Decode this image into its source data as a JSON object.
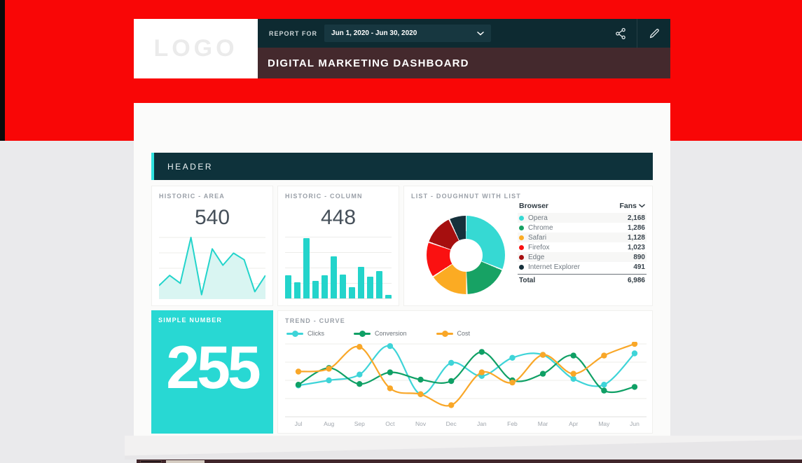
{
  "colors": {
    "red": "#f90606",
    "page_bg": "#eaeaec",
    "topbar_bg": "#0d2a31",
    "dropdown_bg": "#173740",
    "titlebar_bg": "#44292d",
    "banner_bg": "#0e323b",
    "accent_cyan": "#2fe2df",
    "teal": "#23d4cb",
    "simple_number_bg": "#28d8d3"
  },
  "logo": {
    "text": "LOGO"
  },
  "topbar": {
    "report_for_label": "REPORT FOR",
    "date_range": "Jun 1, 2020 - Jun 30, 2020",
    "share_icon": "share-icon",
    "edit_icon": "pencil-icon",
    "chevron_icon": "chevron-down-icon"
  },
  "titlebar": {
    "title": "DIGITAL MARKETING DASHBOARD"
  },
  "banner": {
    "label": "HEADER"
  },
  "cards": {
    "historic_area": {
      "title": "HISTORIC - AREA",
      "value": "540",
      "chart_data": {
        "type": "area",
        "values": [
          20,
          37,
          24,
          100,
          5,
          81,
          54,
          74,
          63,
          10,
          37
        ],
        "ylim": [
          0,
          100
        ],
        "color": "#23d4cb",
        "fill": "#d9f5f2",
        "grid": true
      }
    },
    "historic_column": {
      "title": "HISTORIC - COLUMN",
      "value": "448",
      "chart_data": {
        "type": "bar",
        "values": [
          36,
          25,
          95,
          28,
          36,
          66,
          37,
          18,
          50,
          34,
          43,
          6
        ],
        "ylim": [
          0,
          100
        ],
        "color": "#23d4cb",
        "grid": true
      }
    },
    "doughnut_list": {
      "title": "LIST - DOUGHNUT WITH LIST",
      "chart_data": {
        "type": "pie",
        "labels": [
          "Opera",
          "Chrome",
          "Safari",
          "Firefox",
          "Edge",
          "Internet Explorer"
        ],
        "values": [
          2168,
          1286,
          1128,
          1023,
          890,
          491
        ],
        "colors": [
          "#36d9d3",
          "#17a264",
          "#fbab23",
          "#fa1111",
          "#a60f0f",
          "#16313c"
        ],
        "hole": 0.42,
        "total": 6986
      },
      "table": {
        "col_browser": "Browser",
        "col_fans": "Fans",
        "rows": [
          {
            "label": "Opera",
            "value": "2,168",
            "color": "#36d9d3"
          },
          {
            "label": "Chrome",
            "value": "1,286",
            "color": "#17a264"
          },
          {
            "label": "Safari",
            "value": "1,128",
            "color": "#fbab23"
          },
          {
            "label": "Firefox",
            "value": "1,023",
            "color": "#fa1111"
          },
          {
            "label": "Edge",
            "value": "890",
            "color": "#a60f0f"
          },
          {
            "label": "Internet Explorer",
            "value": "491",
            "color": "#16313c"
          }
        ],
        "total_label": "Total",
        "total_value": "6,986"
      }
    },
    "simple_number": {
      "title": "SIMPLE NUMBER",
      "value": "255"
    },
    "trend_curve": {
      "title": "TREND - CURVE",
      "chart_data": {
        "type": "line",
        "x": [
          "Jul",
          "Aug",
          "Sep",
          "Oct",
          "Nov",
          "Dec",
          "Jan",
          "Feb",
          "Mar",
          "Apr",
          "May",
          "Jun"
        ],
        "series": [
          {
            "name": "Clicks",
            "color": "#3ed4d8",
            "values": [
              43,
              50,
              58,
              97,
              31,
              74,
              56,
              81,
              85,
              52,
              44,
              87
            ]
          },
          {
            "name": "Conversion",
            "color": "#0fa065",
            "values": [
              44,
              67,
              45,
              61,
              51,
              49,
              89,
              50,
              59,
              84,
              36,
              41
            ]
          },
          {
            "name": "Cost",
            "color": "#f9a728",
            "values": [
              62,
              66,
              96,
              39,
              31,
              16,
              61,
              47,
              85,
              59,
              84,
              100
            ]
          }
        ],
        "ylim": [
          0,
          100
        ],
        "grid": true,
        "legend_position": "top"
      }
    }
  }
}
